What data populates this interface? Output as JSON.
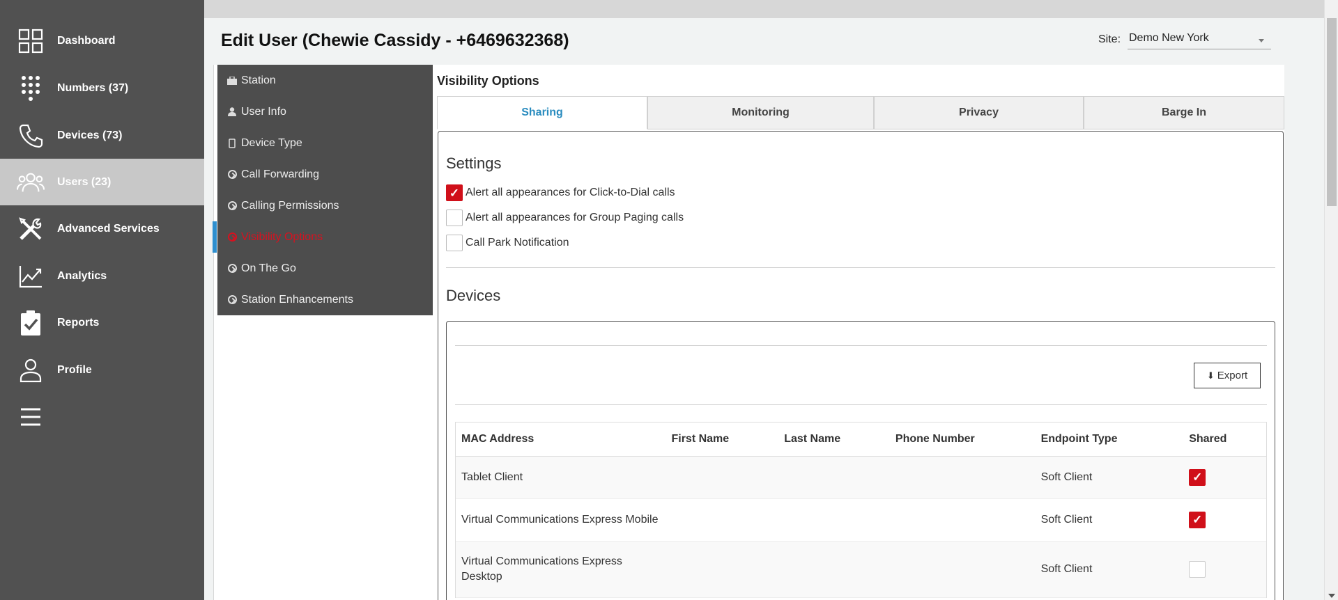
{
  "sidebar": {
    "items": [
      {
        "label": "Dashboard",
        "icon": "grid-icon"
      },
      {
        "label": "Numbers (37)",
        "icon": "dialpad-icon"
      },
      {
        "label": "Devices (73)",
        "icon": "phone-icon"
      },
      {
        "label": "Users (23)",
        "icon": "users-icon",
        "active": true
      },
      {
        "label": "Advanced Services",
        "icon": "tools-icon"
      },
      {
        "label": "Analytics",
        "icon": "chart-line-icon"
      },
      {
        "label": "Reports",
        "icon": "clipboard-check-icon"
      },
      {
        "label": "Profile",
        "icon": "user-icon"
      }
    ],
    "menu_icon": "hamburger-icon"
  },
  "header": {
    "title": "Edit User (Chewie Cassidy - +6469632368)",
    "site_label": "Site:",
    "site_value": "Demo New York"
  },
  "subnav": {
    "items": [
      {
        "label": "Station",
        "icon": "briefcase-icon"
      },
      {
        "label": "User Info",
        "icon": "user-icon"
      },
      {
        "label": "Device Type",
        "icon": "mobile-icon"
      },
      {
        "label": "Call Forwarding",
        "icon": "arrow-circle-icon"
      },
      {
        "label": "Calling Permissions",
        "icon": "arrow-circle-icon"
      },
      {
        "label": "Visibility Options",
        "icon": "arrow-circle-icon",
        "active": true
      },
      {
        "label": "On The Go",
        "icon": "arrow-circle-icon"
      },
      {
        "label": "Station Enhancements",
        "icon": "arrow-circle-icon"
      }
    ]
  },
  "main": {
    "section_title": "Visibility Options",
    "tabs": [
      {
        "label": "Sharing",
        "active": true
      },
      {
        "label": "Monitoring"
      },
      {
        "label": "Privacy"
      },
      {
        "label": "Barge In"
      }
    ],
    "settings_heading": "Settings",
    "settings": [
      {
        "label": "Alert all appearances for Click-to-Dial calls",
        "checked": true
      },
      {
        "label": "Alert all appearances for Group Paging calls",
        "checked": false
      },
      {
        "label": "Call Park Notification",
        "checked": false
      }
    ],
    "devices_heading": "Devices",
    "export_label": "Export",
    "table": {
      "headers": [
        "MAC Address",
        "First Name",
        "Last Name",
        "Phone Number",
        "Endpoint Type",
        "Shared"
      ],
      "rows": [
        {
          "mac": "Tablet Client",
          "first": "",
          "last": "",
          "phone": "",
          "endpoint": "Soft Client",
          "shared": true
        },
        {
          "mac": "Virtual Communications Express Mobile",
          "first": "",
          "last": "",
          "phone": "",
          "endpoint": "Soft Client",
          "shared": true
        },
        {
          "mac": "Virtual Communications Express Desktop",
          "first": "",
          "last": "",
          "phone": "",
          "endpoint": "Soft Client",
          "shared": false
        }
      ]
    }
  },
  "colors": {
    "sidebar_bg": "#515151",
    "accent_red": "#d0101a",
    "tab_active": "#2a8cbf",
    "active_indicator": "#2e8fcf"
  }
}
